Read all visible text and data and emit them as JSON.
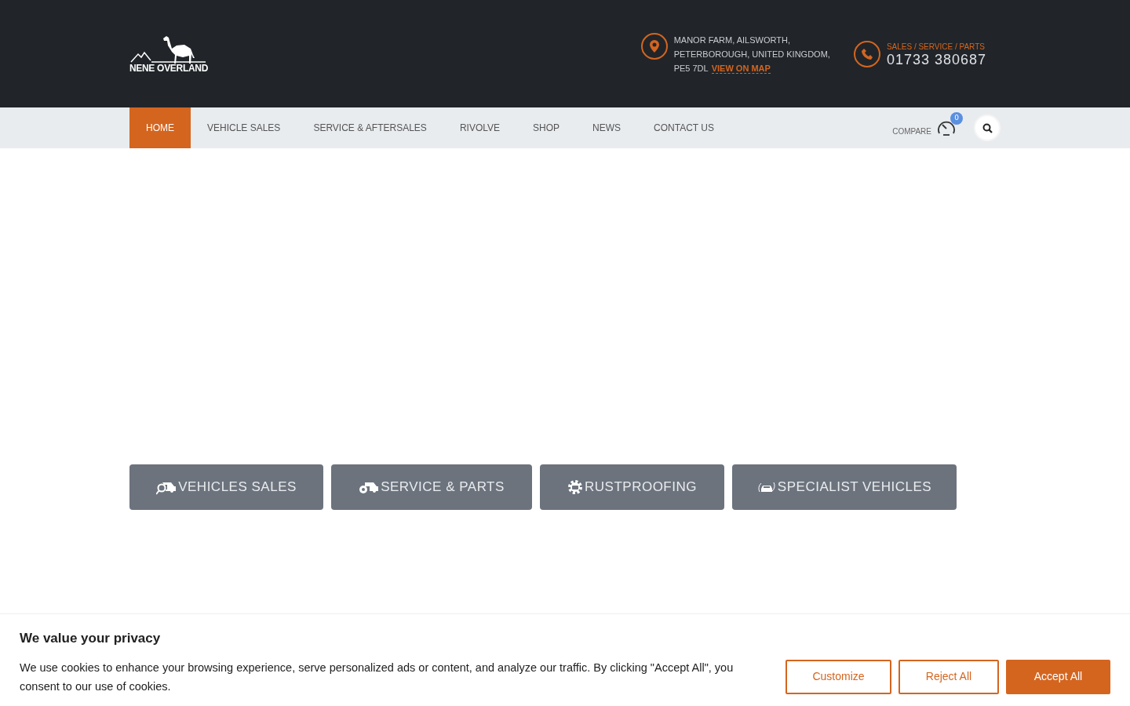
{
  "logo": {
    "text": "NENE OVERLAND"
  },
  "address": {
    "lines": [
      "MANOR FARM, AILSWORTH,",
      "PETERBOROUGH, UNITED KINGDOM,",
      "PE5 7DL"
    ],
    "map_link": "VIEW ON MAP"
  },
  "phone": {
    "label": "SALES / SERVICE / PARTS",
    "number": "01733 380687"
  },
  "nav": [
    {
      "label": "HOME",
      "selected": true
    },
    {
      "label": "VEHICLE SALES",
      "selected": false
    },
    {
      "label": "SERVICE & AFTERSALES",
      "selected": false
    },
    {
      "label": "RIVOLVE",
      "selected": false
    },
    {
      "label": "SHOP",
      "selected": false
    },
    {
      "label": "NEWS",
      "selected": false
    },
    {
      "label": "CONTACT US",
      "selected": false
    }
  ],
  "compare": {
    "label": "COMPARE",
    "count": "0"
  },
  "quick_links": [
    {
      "label": "VEHICLES SALES",
      "kind": "search-car"
    },
    {
      "label": "SERVICE & PARTS",
      "kind": "car-wrench"
    },
    {
      "label": "RUSTPROOFING",
      "kind": "gear-car"
    },
    {
      "label": "SPECIALIST VEHICLES",
      "kind": "car-rotate"
    }
  ],
  "cookie": {
    "title": "We value your privacy",
    "text": "We use cookies to enhance your browsing experience, serve personalized ads or content, and analyze our traffic. By clicking \"Accept All\", you consent to our use of cookies.",
    "buttons": [
      {
        "label": "Customize",
        "kind": "outline"
      },
      {
        "label": "Reject All",
        "kind": "outline"
      },
      {
        "label": "Accept All",
        "kind": "solid"
      }
    ]
  }
}
